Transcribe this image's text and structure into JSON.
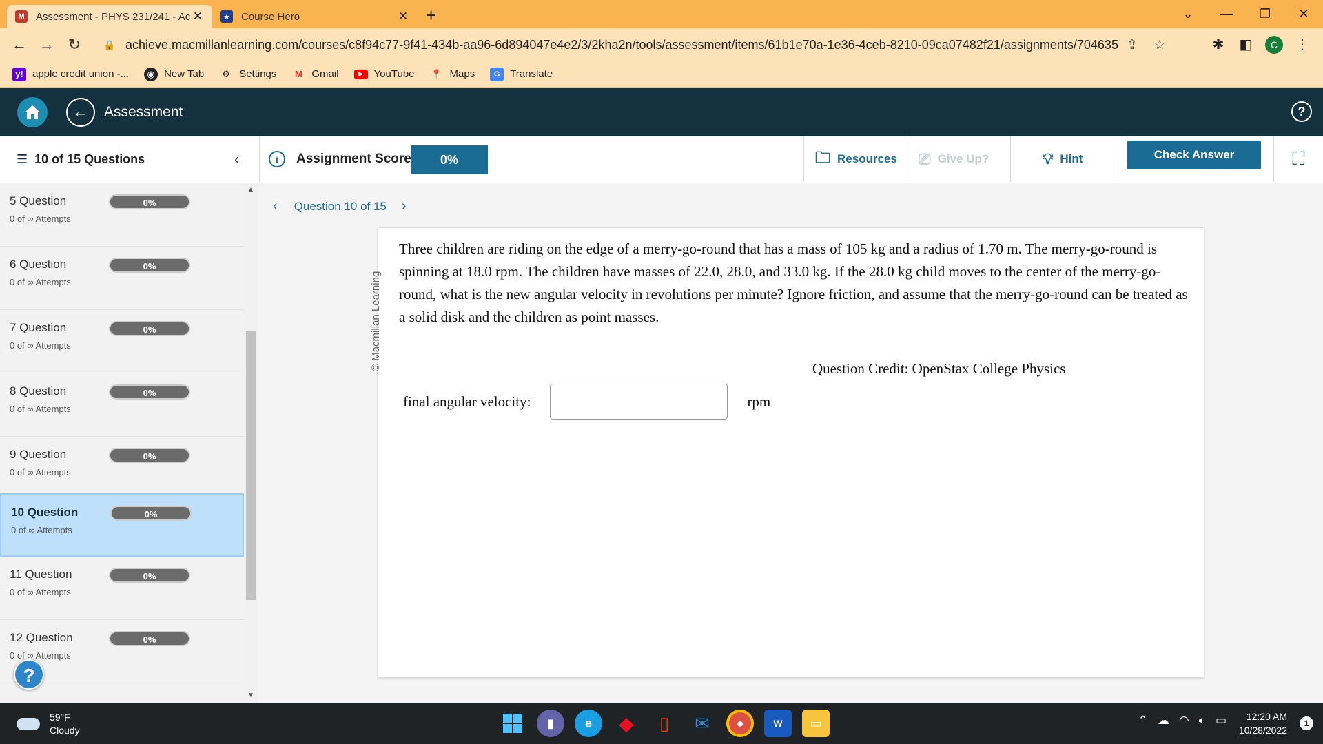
{
  "browser": {
    "tabs": [
      {
        "title": "Assessment - PHYS 231/241 - Ac",
        "active": true
      },
      {
        "title": "Course Hero",
        "active": false
      }
    ],
    "url": "achieve.macmillanlearning.com/courses/c8f94c77-9f41-434b-aa96-6d894047e4e2/3/2kha2n/tools/assessment/items/61b1e70a-1e36-4ceb-8210-09ca07482f21/assignments/7046357?redirec...",
    "profile_initial": "C",
    "bookmarks": [
      "apple credit union -...",
      "New Tab",
      "Settings",
      "Gmail",
      "YouTube",
      "Maps",
      "Translate"
    ],
    "accent": "#f9b44f"
  },
  "app": {
    "title": "Assessment",
    "header_color": "#14313f",
    "primary_color": "#1b6c94"
  },
  "subhead": {
    "question_count": "10 of 15 Questions",
    "score_label": "Assignment Score:",
    "score_value": "0%",
    "resources": "Resources",
    "give_up": "Give Up?",
    "hint": "Hint",
    "check_answer": "Check Answer"
  },
  "sidebar": {
    "items": [
      {
        "label": "5 Question",
        "progress": "0%",
        "attempts": "0 of ∞ Attempts",
        "active": false
      },
      {
        "label": "6 Question",
        "progress": "0%",
        "attempts": "0 of ∞ Attempts",
        "active": false
      },
      {
        "label": "7 Question",
        "progress": "0%",
        "attempts": "0 of ∞ Attempts",
        "active": false
      },
      {
        "label": "8 Question",
        "progress": "0%",
        "attempts": "0 of ∞ Attempts",
        "active": false
      },
      {
        "label": "9 Question",
        "progress": "0%",
        "attempts": "0 of ∞ Attempts",
        "active": false
      },
      {
        "label": "10 Question",
        "progress": "0%",
        "attempts": "0 of ∞ Attempts",
        "active": true
      },
      {
        "label": "11 Question",
        "progress": "0%",
        "attempts": "0 of ∞ Attempts",
        "active": false
      },
      {
        "label": "12 Question",
        "progress": "0%",
        "attempts": "0 of ∞ Attempts",
        "active": false
      }
    ]
  },
  "question": {
    "nav_label": "Question 10 of 15",
    "watermark": "© Macmillan Learning",
    "text": "Three children are riding on the edge of a merry-go-round that has a mass of 105 kg and a radius of 1.70 m. The merry-go-round is spinning at 18.0 rpm. The children have masses of 22.0, 28.0, and 33.0 kg. If the 28.0 kg child moves to the center of the merry-go-round, what is the new angular velocity in revolutions per minute? Ignore friction, and assume that the merry-go-round can be treated as a solid disk and the children as point masses.",
    "credit": "Question Credit: OpenStax College Physics",
    "answer_label": "final angular velocity:",
    "answer_value": "",
    "answer_unit": "rpm"
  },
  "taskbar": {
    "temperature": "59°F",
    "condition": "Cloudy",
    "time": "12:20 AM",
    "date": "10/28/2022",
    "notifications": "1"
  }
}
